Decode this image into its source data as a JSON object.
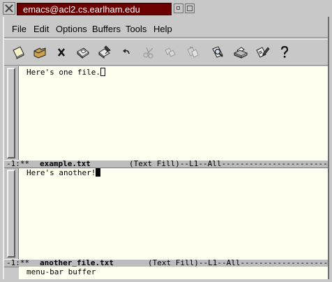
{
  "window": {
    "title": "emacs@acl2.cs.earlham.edu",
    "controls": [
      "minimize",
      "maximize",
      "close"
    ]
  },
  "menubar": {
    "items": [
      "File",
      "Edit",
      "Options",
      "Buffers",
      "Tools",
      "Help"
    ]
  },
  "toolbar": {
    "tools": [
      {
        "name": "new-file-icon",
        "enabled": true
      },
      {
        "name": "open-folder-icon",
        "enabled": true
      },
      {
        "name": "kill-buffer-icon",
        "enabled": true
      },
      {
        "name": "save-disk-icon",
        "enabled": true
      },
      {
        "name": "save-as-icon",
        "enabled": true
      },
      {
        "name": "undo-icon",
        "enabled": true
      },
      {
        "name": "cut-icon",
        "enabled": false
      },
      {
        "name": "copy-icon",
        "enabled": false
      },
      {
        "name": "paste-icon",
        "enabled": false
      },
      {
        "name": "search-icon",
        "enabled": true
      },
      {
        "name": "print-icon",
        "enabled": true
      },
      {
        "name": "customize-icon",
        "enabled": true
      },
      {
        "name": "help-icon",
        "enabled": true
      }
    ]
  },
  "windows": [
    {
      "text": "Here's one file.",
      "cursor": "hollow",
      "modeline": {
        "prefix": "-1:**",
        "buffer": "example.txt",
        "mode": "(Text Fill)--L1--All-----------------------"
      }
    },
    {
      "text": "Here's another!",
      "cursor": "solid",
      "modeline": {
        "prefix": "-1:**",
        "buffer": "another_file.txt",
        "mode": "(Text Fill)--L1--All-----------------------"
      }
    }
  ],
  "minibuffer": {
    "text": "menu-bar buffer"
  },
  "colors": {
    "title_bar": "#6b0000",
    "chrome": "#c8c8c8",
    "text_background": "#fffff0",
    "modeline": "#bcbcbc"
  }
}
